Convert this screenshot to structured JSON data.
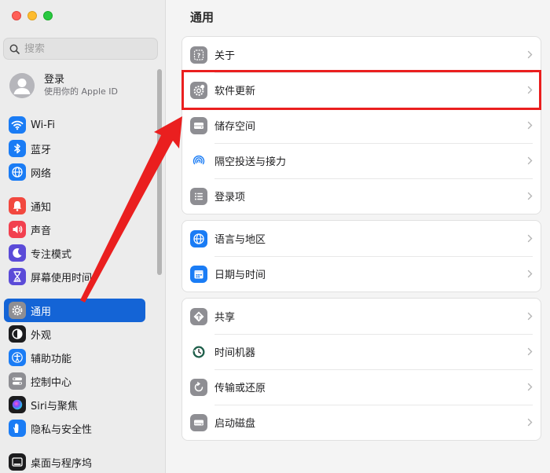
{
  "window": {
    "title": "通用"
  },
  "search": {
    "placeholder": "搜索"
  },
  "account": {
    "name": "登录",
    "subtitle": "使用你的 Apple ID"
  },
  "sidebar": {
    "items": [
      {
        "label": "Wi-Fi",
        "icon": "wifi-icon",
        "color": "#1a7cf5"
      },
      {
        "label": "蓝牙",
        "icon": "bluetooth-icon",
        "color": "#1a7cf5"
      },
      {
        "label": "网络",
        "icon": "globe-icon",
        "color": "#1a7cf5"
      },
      {
        "label": "通知",
        "icon": "bell-icon",
        "color": "#f2483f"
      },
      {
        "label": "声音",
        "icon": "speaker-icon",
        "color": "#f2404f"
      },
      {
        "label": "专注模式",
        "icon": "moon-icon",
        "color": "#5b4bd8"
      },
      {
        "label": "屏幕使用时间",
        "icon": "hourglass-icon",
        "color": "#5b4bd8"
      },
      {
        "label": "通用",
        "icon": "gear-icon",
        "color": "#8e8e93",
        "active": true
      },
      {
        "label": "外观",
        "icon": "appearance-icon",
        "color": "#1c1c1e"
      },
      {
        "label": "辅助功能",
        "icon": "accessibility-icon",
        "color": "#1a7cf5"
      },
      {
        "label": "控制中心",
        "icon": "toggles-icon",
        "color": "#8e8e93"
      },
      {
        "label": "Siri与聚焦",
        "icon": "siri-icon",
        "color": "#1c1c1e"
      },
      {
        "label": "隐私与安全性",
        "icon": "hand-icon",
        "color": "#1a7cf5"
      },
      {
        "label": "桌面与程序坞",
        "icon": "dock-icon",
        "color": "#1c1c1e"
      }
    ]
  },
  "main": {
    "title": "通用",
    "groups": [
      {
        "rows": [
          {
            "label": "关于",
            "icon": "about-icon"
          },
          {
            "label": "软件更新",
            "icon": "software-update-icon"
          },
          {
            "label": "储存空间",
            "icon": "storage-icon"
          },
          {
            "label": "隔空投送与接力",
            "icon": "airdrop-icon"
          },
          {
            "label": "登录项",
            "icon": "login-items-icon"
          }
        ]
      },
      {
        "rows": [
          {
            "label": "语言与地区",
            "icon": "language-globe-icon"
          },
          {
            "label": "日期与时间",
            "icon": "calendar-icon"
          }
        ]
      },
      {
        "rows": [
          {
            "label": "共享",
            "icon": "sharing-icon"
          },
          {
            "label": "时间机器",
            "icon": "time-machine-icon"
          },
          {
            "label": "传输或还原",
            "icon": "transfer-icon"
          },
          {
            "label": "启动磁盘",
            "icon": "startup-disk-icon"
          }
        ]
      }
    ]
  },
  "annotation": {
    "highlight_color": "#ea1f1f"
  }
}
